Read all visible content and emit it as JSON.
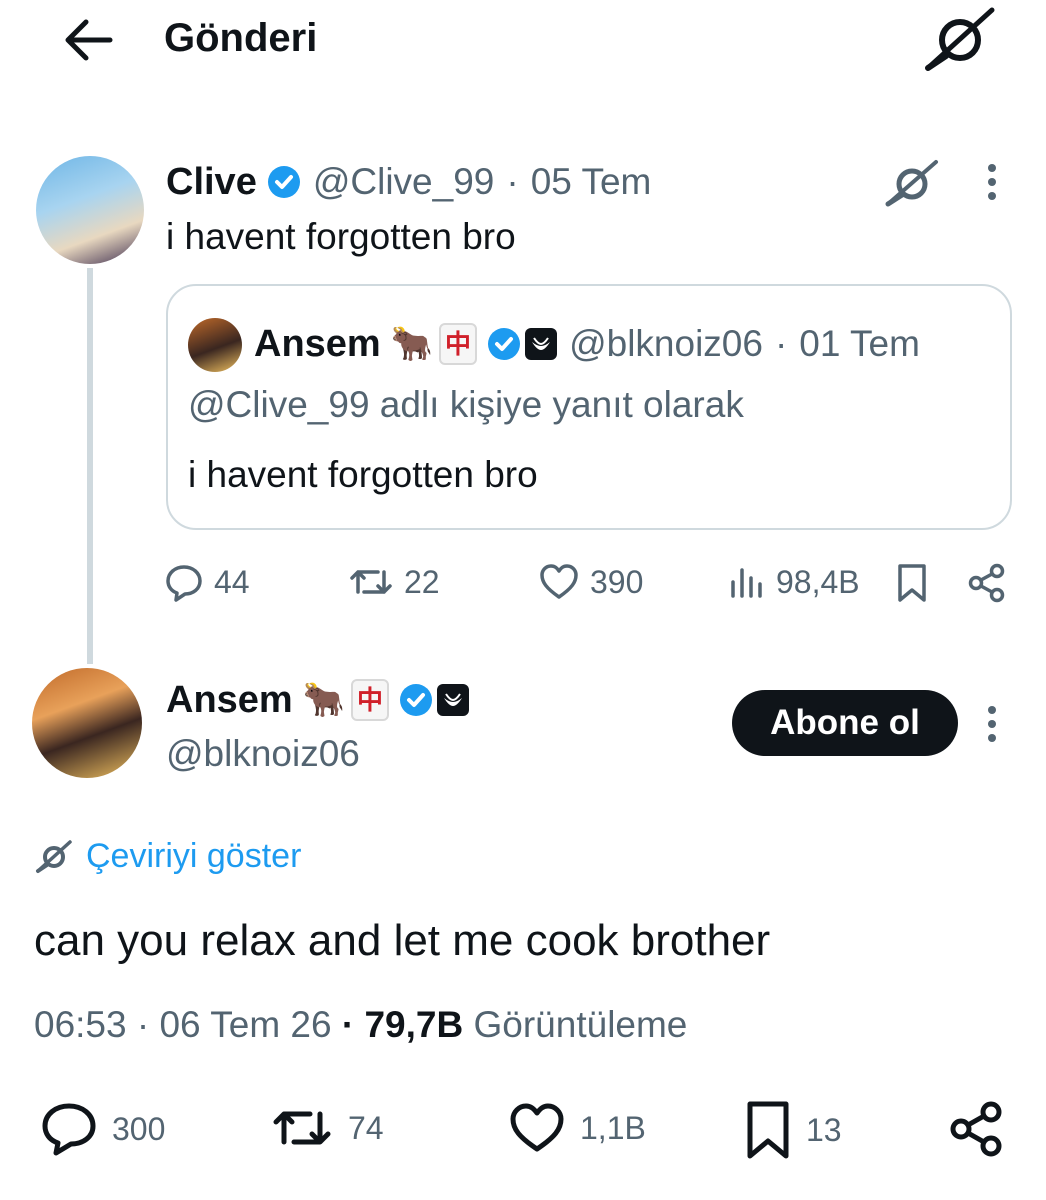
{
  "header": {
    "title": "Gönderi",
    "back_icon": "arrow-left-icon",
    "grok_icon": "grok-icon"
  },
  "parent_tweet": {
    "author_name": "Clive",
    "handle": "@Clive_99",
    "separator": "·",
    "date": "05 Tem",
    "text": "i havent forgotten bro",
    "quote": {
      "author_name": "Ansem",
      "emoji_ox": "🐂",
      "emoji_mahjong": "中",
      "handle": "@blknoiz06",
      "separator": "·",
      "date": "01 Tem",
      "reply_to": "@Clive_99 adlı kişiye yanıt olarak",
      "text": "i havent forgotten bro"
    },
    "actions": {
      "replies": "44",
      "reposts": "22",
      "likes": "390",
      "views": "98,4B"
    }
  },
  "main_tweet": {
    "author_name": "Ansem",
    "emoji_ox": "🐂",
    "emoji_mahjong": "中",
    "handle": "@blknoiz06",
    "follow_label": "Abone ol",
    "translate_label": "Çeviriyi göster",
    "text": "can you relax and let me cook brother",
    "time": "06:53",
    "sep1": "·",
    "date": "06 Tem 26",
    "sep2": "·",
    "views_count": "79,7B",
    "views_label": "Görüntüleme",
    "actions": {
      "replies": "300",
      "reposts": "74",
      "likes": "1,1B",
      "bookmarks": "13"
    }
  },
  "colors": {
    "text": "#0f1419",
    "muted": "#536471",
    "link": "#1d9bf0",
    "verified": "#1d9bf0",
    "border": "#cfd9de"
  }
}
